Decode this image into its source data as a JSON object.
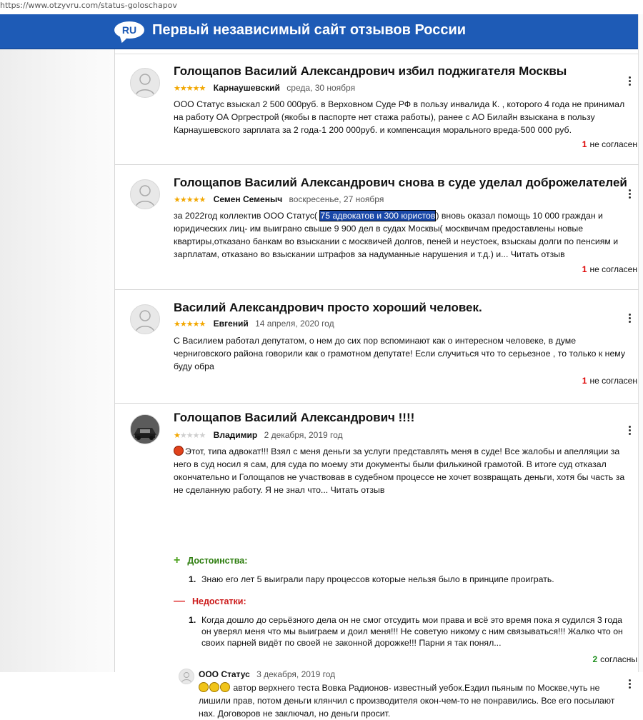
{
  "browser": {
    "url": "https://www.otzyvru.com/status-goloschapov"
  },
  "header": {
    "logo_text": "RU",
    "title": "Первый независимый сайт отзывов России"
  },
  "reviews": [
    {
      "title": "Голощапов Василий Александрович избил поджигателя Москвы",
      "rating": 5,
      "author": "Карнаушевский",
      "date": "среда, 30 ноября",
      "body": "ООО Статус взыскал 2 500 000руб. в Верховном Суде РФ в пользу инвалида К. , которого 4 года не принимал на работу ОА Оргрестрой (якобы в паспорте нет стажа работы), ранее с АО Билайн взыскана в пользу Карнаушевского зарплата за 2 года-1 200 000руб. и компенсация морального вреда-500 000 руб.",
      "agree_count": "1",
      "agree_label": "не согласен"
    },
    {
      "title": "Голощапов Василий Александрович снова в суде уделал доброжелателей",
      "rating": 5,
      "author": "Семен Семеныч",
      "date": "воскресенье, 27 ноября",
      "body_before": "за 2022год коллектив ООО Статус( ",
      "body_highlight": "75 адвокатов и 300 юристов",
      "body_after": ") вновь оказал помощь 10 000 граждан и юридических лиц- им выиграно свыше 9 900 дел в судах Москвы( москвичам предоставлены новые квартиры,отказано банкам во взыскании с москвичей долгов, пеней и неустоек, взыскаы долги по пенсиям и зарплатам, отказано во взыскании штрафов за надуманные нарушения и т.д.) и...",
      "read_more": "Читать отзыв",
      "agree_count": "1",
      "agree_label": "не согласен"
    },
    {
      "title": "Василий Александрович просто хороший человек.",
      "rating": 5,
      "author": "Евгений",
      "date": "14 апреля, 2020 год",
      "body": "С Василием работал депутатом, о нем до сих пор вспоминают как о интересном человеке, в думе черниговского района говорили как о грамотном депутате! Если случиться что то серьезное , то только к нему буду обра",
      "agree_count": "1",
      "agree_label": "не согласен"
    },
    {
      "title": "Голощапов Василий Александрович !!!!",
      "rating": 1,
      "author": "Владимир",
      "date": "2 декабря, 2019 год",
      "body": "Этот, типа адвокат!!! Взял с меня деньги за услуги представлять меня в суде! Все жалобы и апелляции за него в суд носил я сам, для суда по моему эти документы были филькиной грамотой. В итоге суд отказал окончательно и Голощапов не участвовав в судебном процессе не хочет возвращать деньги, хотя бы часть за не сделанную работу. Я не знал что...",
      "read_more": "Читать отзыв",
      "pros_title": "Достоинства:",
      "pros": [
        "Знаю его лет 5 выиграли пару процессов которые нельзя было в принципе проиграть."
      ],
      "cons_title": "Недостатки:",
      "cons": [
        "Когда дошло до серьёзного дела он не смог отсудить мои права и всё это время пока я судился 3 года он уверял меня что мы выиграем и доил меня!!! Не советую никому с ним связываться!!! Жалко что он своих парней видёт по своей не законной дорожке!!! Парни я так понял..."
      ],
      "agree_count": "2",
      "agree_label": "согласны"
    }
  ],
  "reply": {
    "author": "ООО Статус",
    "date": "3 декабря, 2019 год",
    "body": "автор верхнего теста Вовка Радионов- известный уебок.Ездил пьяным по Москве,чуть не лишили прав, потом деньги клянчил с производителя окон-чем-то не понравились. Все его посылают нах. Договоров не заключал, но деньги просит."
  },
  "colors": {
    "header": "#1e5bb6",
    "stars": "#f2a700",
    "disagree": "#dd0000",
    "agree": "#1a8d1a",
    "pros": "#2d7d0e",
    "cons": "#cc1a1a",
    "highlight": "#1a48a8"
  },
  "icons": {
    "avatar": "user-silhouette-icon",
    "menu": "kebab-menu-icon",
    "pros": "plus-icon",
    "cons": "minus-icon",
    "emoji": "angry-face-icon",
    "reply_emoji": "smiley-icon"
  }
}
